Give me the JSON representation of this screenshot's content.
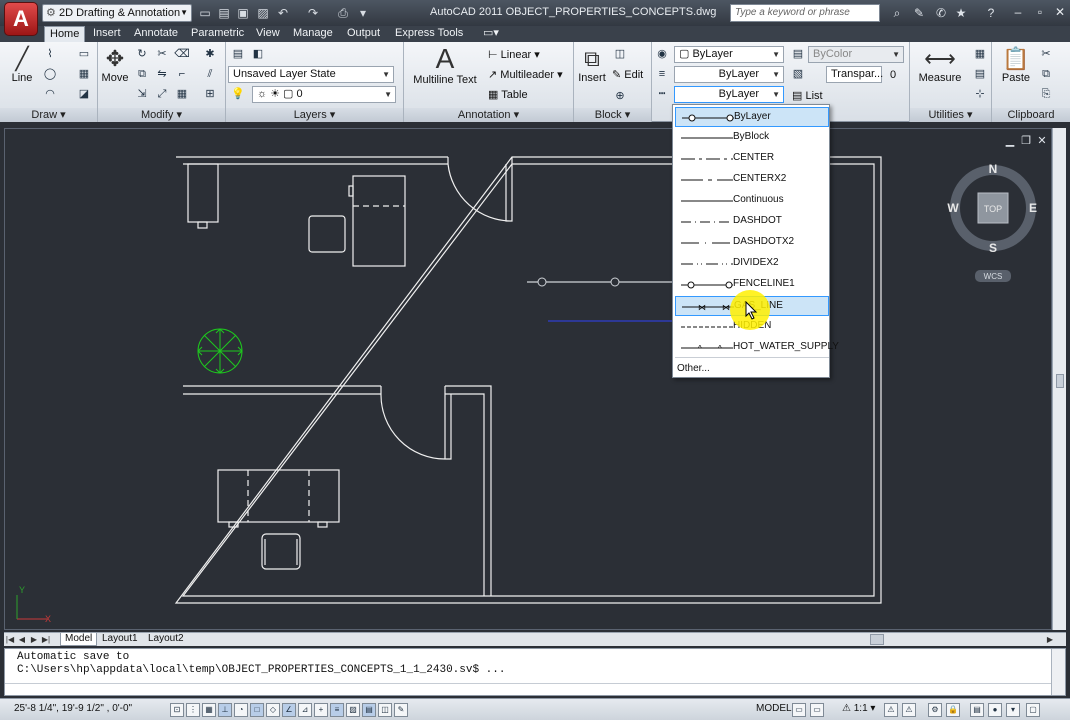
{
  "titlebar": {
    "app_button": "A",
    "workspace": "2D Drafting & Annotation",
    "title": "AutoCAD 2011   OBJECT_PROPERTIES_CONCEPTS.dwg",
    "search_placeholder": "Type a keyword or phrase"
  },
  "tabs": [
    "Home",
    "Insert",
    "Annotate",
    "Parametric",
    "View",
    "Manage",
    "Output",
    "Express Tools"
  ],
  "ribbon": {
    "draw": {
      "title": "Draw",
      "line": "Line"
    },
    "modify": {
      "title": "Modify",
      "move": "Move"
    },
    "layers": {
      "title": "Layers",
      "layer_state": "Unsaved Layer State",
      "layer_value": "0"
    },
    "annotation": {
      "title": "Annotation",
      "mtext": "Multiline Text",
      "linear": "Linear",
      "multileader": "Multileader",
      "table": "Table"
    },
    "block": {
      "title": "Block",
      "insert": "Insert",
      "edit": "Edit"
    },
    "properties": {
      "color": "ByLayer",
      "lineweight": "ByLayer",
      "linetype": "ByLayer",
      "plot_style": "ByColor",
      "transparency": "Transpar...",
      "transparency_value": "0",
      "list": "List"
    },
    "utilities": {
      "title": "Utilities",
      "measure": "Measure"
    },
    "clipboard": {
      "title": "Clipboard",
      "paste": "Paste"
    }
  },
  "viewcube": {
    "n": "N",
    "s": "S",
    "e": "E",
    "w": "W",
    "top": "TOP",
    "wcs": "WCS"
  },
  "ucs": {
    "x": "X",
    "y": "Y"
  },
  "linetype_dropdown": {
    "items": [
      {
        "name": "ByLayer",
        "selected": true
      },
      {
        "name": "ByBlock",
        "selected": false
      },
      {
        "name": "CENTER",
        "selected": false
      },
      {
        "name": "CENTERX2",
        "selected": false
      },
      {
        "name": "Continuous",
        "selected": false
      },
      {
        "name": "DASHDOT",
        "selected": false
      },
      {
        "name": "DASHDOTX2",
        "selected": false
      },
      {
        "name": "DIVIDEX2",
        "selected": false
      },
      {
        "name": "FENCELINE1",
        "selected": false
      },
      {
        "name": "GAS_LINE",
        "selected": true
      },
      {
        "name": "HIDDEN",
        "selected": false
      },
      {
        "name": "HOT_WATER_SUPPLY",
        "selected": false
      }
    ],
    "other": "Other..."
  },
  "layout_tabs": [
    "Model",
    "Layout1",
    "Layout2"
  ],
  "command_line": {
    "line1": "Automatic save to",
    "line2": "C:\\Users\\hp\\appdata\\local\\temp\\OBJECT_PROPERTIES_CONCEPTS_1_1_2430.sv$ ..."
  },
  "statusbar": {
    "coords": "25'-8 1/4\",  19'-9 1/2\" , 0'-0\"",
    "model": "MODEL",
    "scale": "1:1"
  },
  "colors": {
    "accent": "#3399ff",
    "selection": "#cce4f7",
    "drawing_bg": "#2b2f36",
    "plant": "#1ec81e",
    "cursor_highlight": "#fff000"
  }
}
